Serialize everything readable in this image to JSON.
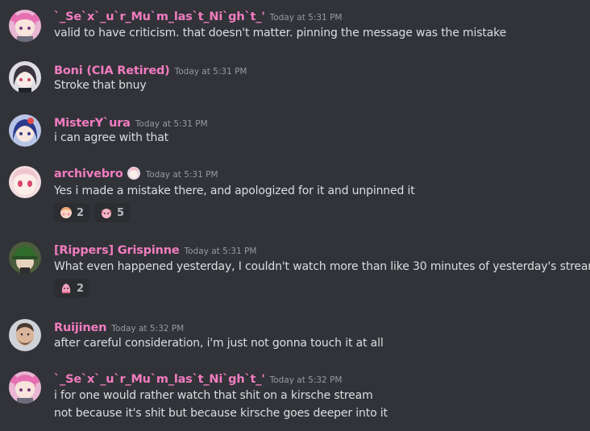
{
  "messages": [
    {
      "author": "`_Se`x`_u`r_Mu`m_las`t_Ni`gh`t_'",
      "timestamp": "Today at 5:31 PM",
      "lines": [
        "valid to have criticism. that doesn't matter. pinning the message was the mistake"
      ],
      "avatar": "pink-hair-anime-avatar",
      "reactions": []
    },
    {
      "author": "Boni (CIA Retired)",
      "timestamp": "Today at 5:31 PM",
      "lines": [
        "Stroke that bnuy"
      ],
      "avatar": "dark-hair-anime-avatar",
      "reactions": []
    },
    {
      "author": "MisterY`ura",
      "timestamp": "Today at 5:31 PM",
      "lines": [
        "i can agree with that"
      ],
      "avatar": "blue-hair-anime-avatar",
      "reactions": []
    },
    {
      "author": "archivebro",
      "timestamp": "Today at 5:31 PM",
      "lines": [
        "Yes i made a mistake there, and apologized for it and unpinned it"
      ],
      "avatar": "pink-eyes-anime-avatar",
      "badge": "anime-girl-badge-icon",
      "reactions": [
        {
          "emoji": "blush-emoji",
          "count": "2"
        },
        {
          "emoji": "pink-character-emoji",
          "count": "5"
        }
      ]
    },
    {
      "author": "[Rippers] Grispinne",
      "timestamp": "Today at 5:31 PM",
      "lines": [
        "What even happened yesterday, I couldn't watch more than like 30 minutes of yesterday's stream"
      ],
      "avatar": "green-cap-avatar",
      "reactions": [
        {
          "emoji": "pink-blob-emoji",
          "count": "2"
        }
      ]
    },
    {
      "author": "Ruijinen",
      "timestamp": "Today at 5:32 PM",
      "lines": [
        "after careful consideration, i'm just not gonna touch it at all"
      ],
      "avatar": "bearded-man-avatar",
      "reactions": []
    },
    {
      "author": "`_Se`x`_u`r_Mu`m_las`t_Ni`gh`t_'",
      "timestamp": "Today at 5:32 PM",
      "lines": [
        "i for one would rather watch that shit on a kirsche stream",
        "not because it's shit but because kirsche goes deeper into it"
      ],
      "avatar": "pink-hair-anime-avatar",
      "reactions": []
    }
  ],
  "colors": {
    "background": "#313338",
    "username": "#f27cc0",
    "timestamp": "#949ba4",
    "text": "#dbdee1",
    "reaction_bg": "#2b2d31"
  }
}
